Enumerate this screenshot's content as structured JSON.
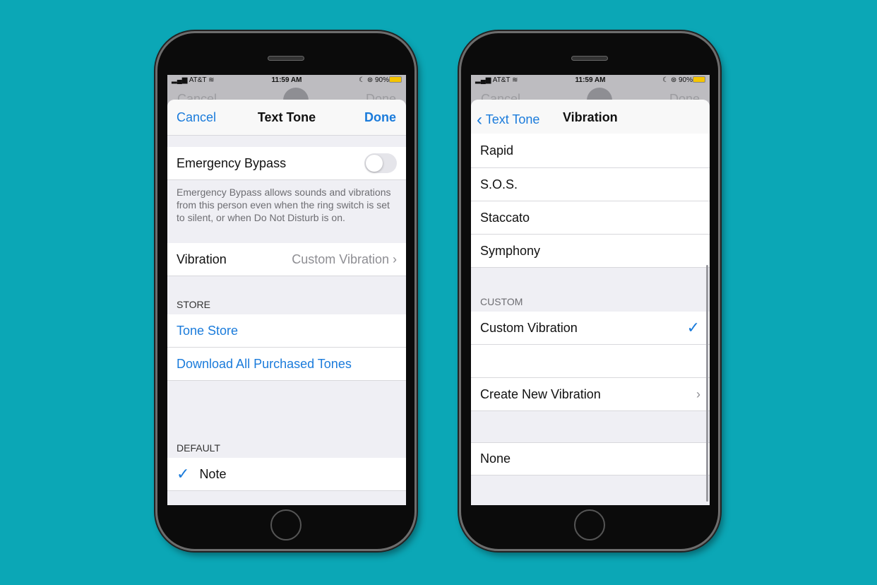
{
  "status": {
    "carrier": "AT&T",
    "time": "11:59 AM",
    "battery": "90%"
  },
  "behind": {
    "cancel": "Cancel",
    "done": "Done"
  },
  "left": {
    "nav": {
      "cancel": "Cancel",
      "title": "Text Tone",
      "done": "Done"
    },
    "emergency_bypass": {
      "label": "Emergency Bypass",
      "on": false,
      "description": "Emergency Bypass allows sounds and vibrations from this person even when the ring switch is set to silent, or when Do Not Disturb is on."
    },
    "vibration": {
      "label": "Vibration",
      "value": "Custom Vibration"
    },
    "store": {
      "header": "STORE",
      "items": [
        "Tone Store",
        "Download All Purchased Tones"
      ]
    },
    "default": {
      "header": "DEFAULT",
      "item": "Note",
      "checked": true
    }
  },
  "right": {
    "nav": {
      "back": "Text Tone",
      "title": "Vibration"
    },
    "standard": [
      "Rapid",
      "S.O.S.",
      "Staccato",
      "Symphony"
    ],
    "custom": {
      "header": "CUSTOM",
      "selected": "Custom Vibration",
      "create": "Create New Vibration"
    },
    "none": "None"
  },
  "colors": {
    "background": "#0ba7b6",
    "accent": "#1a7bdb"
  }
}
